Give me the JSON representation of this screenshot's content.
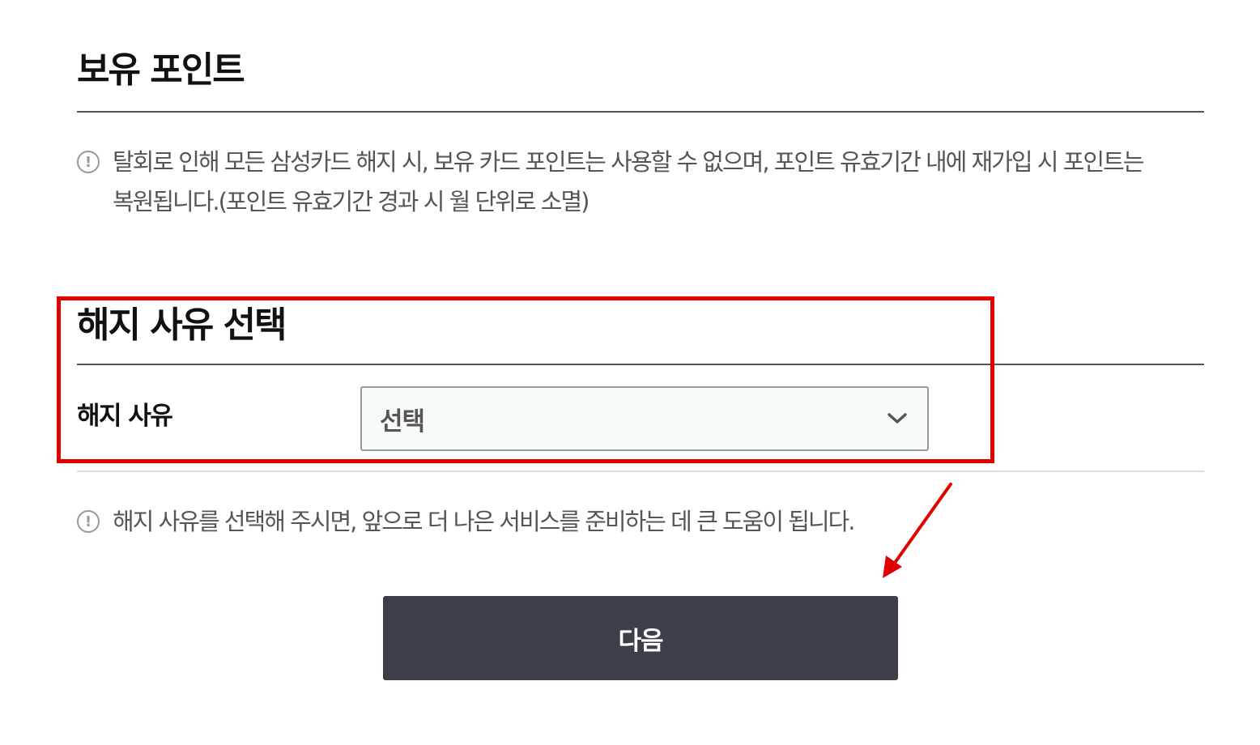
{
  "points_section": {
    "title": "보유 포인트",
    "notice_icon": "info-exclamation-icon",
    "notice_line1": "탈회로 인해 모든 삼성카드 해지 시, 보유 카드 포인트는 사용할 수 없으며, 포인트 유효기간 내에 재가입 시 포인트는",
    "notice_line2": "복원됩니다.(포인트 유효기간 경과 시 월 단위로 소멸)"
  },
  "reason_section": {
    "title": "해지 사유 선택",
    "field_label": "해지 사유",
    "select": {
      "selected_value": "선택",
      "icon": "chevron-down-icon"
    },
    "notice_icon": "info-exclamation-icon",
    "notice_text": "해지 사유를 선택해 주시면, 앞으로 더 나은 서비스를 준비하는 데 큰 도움이 됩니다."
  },
  "actions": {
    "next_label": "다음"
  },
  "annotations": {
    "highlight_color": "#e00000",
    "arrow_color": "#e00000"
  },
  "colors": {
    "button_bg": "#3c3f47",
    "select_bg": "#f7fafa",
    "notice_text": "#555555"
  }
}
